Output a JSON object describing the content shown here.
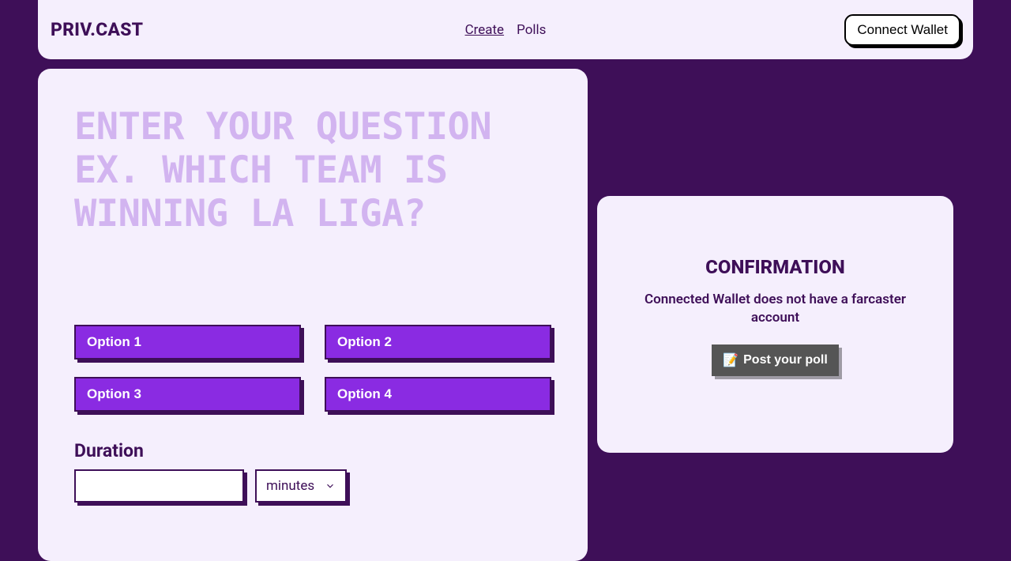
{
  "header": {
    "brand": "PRIV.CAST",
    "nav": {
      "create": "Create",
      "polls": "Polls"
    },
    "connect_label": "Connect Wallet"
  },
  "create": {
    "question_placeholder": "ENTER YOUR QUESTION EX. WHICH TEAM IS WINNING LA LIGA?",
    "options": {
      "o1_placeholder": "Option 1",
      "o2_placeholder": "Option 2",
      "o3_placeholder": "Option 3",
      "o4_placeholder": "Option 4"
    },
    "duration_label": "Duration",
    "unit_selected": "minutes"
  },
  "confirm": {
    "title": "CONFIRMATION",
    "message": "Connected Wallet does not have a farcaster account",
    "post_icon": "📝",
    "post_label": "Post your poll"
  }
}
